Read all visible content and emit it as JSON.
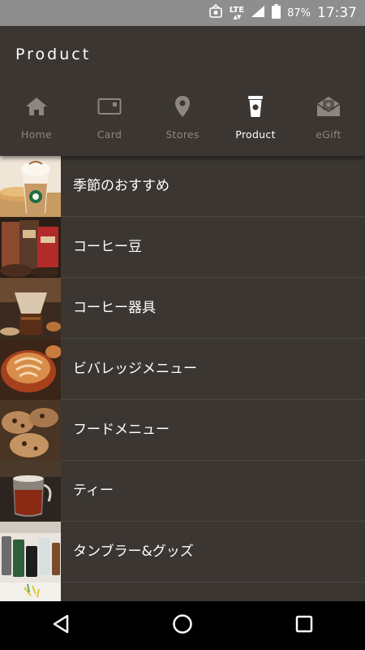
{
  "status_bar": {
    "network": "LTE",
    "battery": "87%",
    "time": "17:37"
  },
  "header": {
    "title": "Product"
  },
  "tabs": [
    {
      "label": "Home",
      "icon": "home-icon",
      "active": false
    },
    {
      "label": "Card",
      "icon": "card-icon",
      "active": false
    },
    {
      "label": "Stores",
      "icon": "map-pin-icon",
      "active": false
    },
    {
      "label": "Product",
      "icon": "cup-icon",
      "active": true
    },
    {
      "label": "eGift",
      "icon": "envelope-icon",
      "active": false
    }
  ],
  "list": {
    "items": [
      {
        "label": "季節のおすすめ"
      },
      {
        "label": "コーヒー豆"
      },
      {
        "label": "コーヒー器具"
      },
      {
        "label": "ビバレッジメニュー"
      },
      {
        "label": "フードメニュー"
      },
      {
        "label": "ティー"
      },
      {
        "label": "タンブラー&グッズ"
      },
      {
        "label": ""
      }
    ]
  },
  "colors": {
    "background": "#3b3632",
    "status_bar": "#8e8e8e",
    "inactive_tab": "#8c8580",
    "nav_bar": "#000000"
  }
}
